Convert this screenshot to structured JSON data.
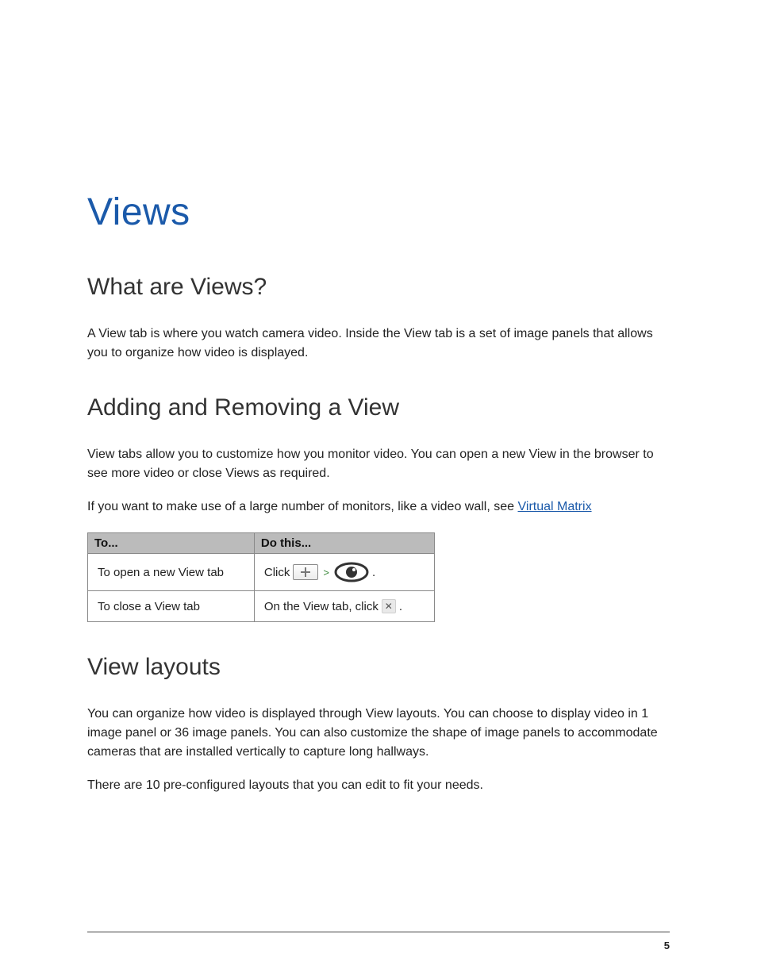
{
  "title": "Views",
  "sections": {
    "what": {
      "heading": "What are Views?",
      "p1": "A View tab is where you watch camera video. Inside the View tab is a set of image panels that allows you to organize how video is displayed."
    },
    "addremove": {
      "heading": "Adding and Removing a View",
      "p1": "View tabs allow you to customize how you monitor video. You can open a new View in the browser to see more video or close Views as required.",
      "p2_prefix": "If you want to make use of a large number of monitors, like a video wall, see ",
      "p2_link": "Virtual Matrix"
    },
    "layouts": {
      "heading": "View layouts",
      "p1": "You can organize how video is displayed through View layouts. You can choose to display video in 1 image panel or 36 image panels. You can also customize the shape of image panels to accommodate cameras that are installed vertically to capture long hallways.",
      "p2": "There are 10 pre-configured layouts that you can edit to fit your needs."
    }
  },
  "table": {
    "headers": {
      "to": "To...",
      "do": "Do this..."
    },
    "rows": [
      {
        "to": "To open a new View tab",
        "do_prefix": "Click",
        "do_suffix": "."
      },
      {
        "to": "To close a View tab",
        "do_prefix": "On the View tab, click ",
        "do_suffix": "."
      }
    ]
  },
  "page_number": "5"
}
